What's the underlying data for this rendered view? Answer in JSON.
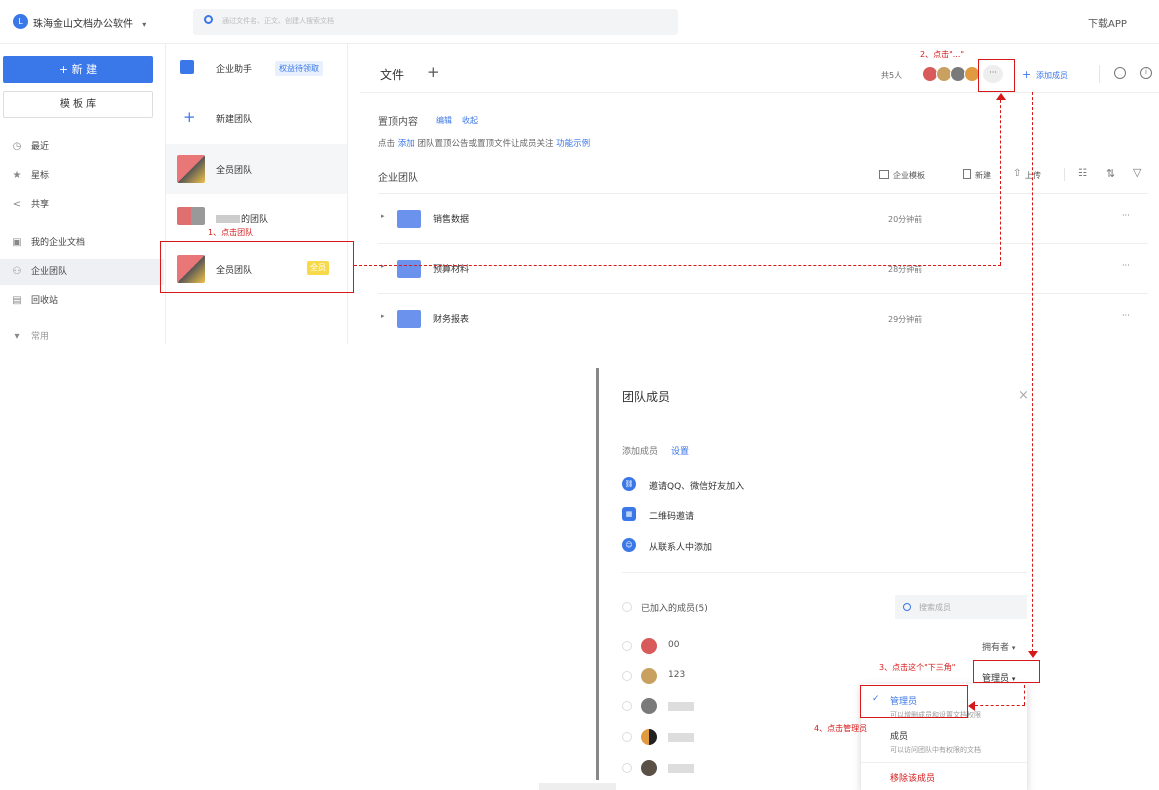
{
  "topbar": {
    "logo": "L",
    "company": "珠海金山文档办公软件",
    "company_caret": "▾",
    "search_placeholder": "通过文件名、正文、创建人搜索文档",
    "download": "下载APP"
  },
  "sidebar": {
    "new_label": "+ 新 建",
    "template_label": "模 板 库",
    "nav": [
      {
        "icon": "clock-icon",
        "glyph": "◷",
        "label": "最近"
      },
      {
        "icon": "star-icon",
        "glyph": "★",
        "label": "星标"
      },
      {
        "icon": "share-icon",
        "glyph": "<",
        "label": "共享"
      },
      {
        "icon": "doc-icon",
        "glyph": "▣",
        "label": "我的企业文档"
      },
      {
        "icon": "team-icon",
        "glyph": "⚇",
        "label": "企业团队"
      },
      {
        "icon": "trash-icon",
        "glyph": "▤",
        "label": "回收站"
      },
      {
        "icon": "collapse-icon",
        "glyph": "▾",
        "label": "常用"
      }
    ]
  },
  "teams": {
    "assistant": {
      "label": "企业助手",
      "badge": "权益待领取"
    },
    "new_team": {
      "label": "新建团队",
      "glyph": "+"
    },
    "items": [
      {
        "label": "全员团队"
      },
      {
        "label": "的团队"
      },
      {
        "label": "全员团队",
        "badge": "全员"
      }
    ]
  },
  "main": {
    "tab": "文件",
    "add_tab": "+",
    "member_count": "共5人",
    "more": "···",
    "add_member": "添加成员",
    "add_member_glyph": "+",
    "pinned_title": "置顶内容",
    "edit": "编辑",
    "collapse": "收起",
    "pinned_prefix": "点击",
    "pinned_add": "添加",
    "pinned_text": "团队置顶公告或置顶文件让成员关注",
    "pinned_example": "功能示例",
    "section": "企业团队",
    "toolbar": {
      "template": "企业模板",
      "new": "新建",
      "upload": "上传"
    },
    "folders": [
      {
        "name": "销售数据",
        "time": "20分钟前"
      },
      {
        "name": "预算材料",
        "time": "28分钟前"
      },
      {
        "name": "财务报表",
        "time": "29分钟前"
      }
    ],
    "row_more": "···"
  },
  "annotations": {
    "step1": "1、点击团队",
    "step2": "2、点击\"...\"",
    "step3": "3、点击这个\"下三角\"",
    "step4": "4、点击管理员"
  },
  "panel": {
    "title": "团队成员",
    "close": "×",
    "add_member": "添加成员",
    "settings": "设置",
    "invites": [
      {
        "icon": "link-icon",
        "glyph": "⛓",
        "label": "邀请QQ、微信好友加入"
      },
      {
        "icon": "qrcode-icon",
        "glyph": "▦",
        "label": "二维码邀请"
      },
      {
        "icon": "contacts-icon",
        "glyph": "☺",
        "label": "从联系人中添加"
      }
    ],
    "joined": "已加入的成员(5)",
    "search_placeholder": "搜索成员",
    "members": [
      {
        "name": "00",
        "role": "拥有者",
        "color": "#d95a5a"
      },
      {
        "name": "123",
        "role": "管理员",
        "color": "#c8a060"
      },
      {
        "name": "",
        "role": "",
        "color": "#7a7a7a"
      },
      {
        "name": "",
        "role": "",
        "color": "#e09a40"
      },
      {
        "name": "",
        "role": "",
        "color": "#5a5046"
      }
    ],
    "dropdown": {
      "check": "✓",
      "admin": "管理员",
      "admin_desc": "可以增删成员和设置文档权限",
      "member": "成员",
      "member_desc": "可以访问团队中有权限的文档",
      "remove": "移除该成员"
    }
  },
  "colors": {
    "accent": "#3a77e8",
    "annotation": "#d61818",
    "badge_yellow": "#f7d94c"
  }
}
